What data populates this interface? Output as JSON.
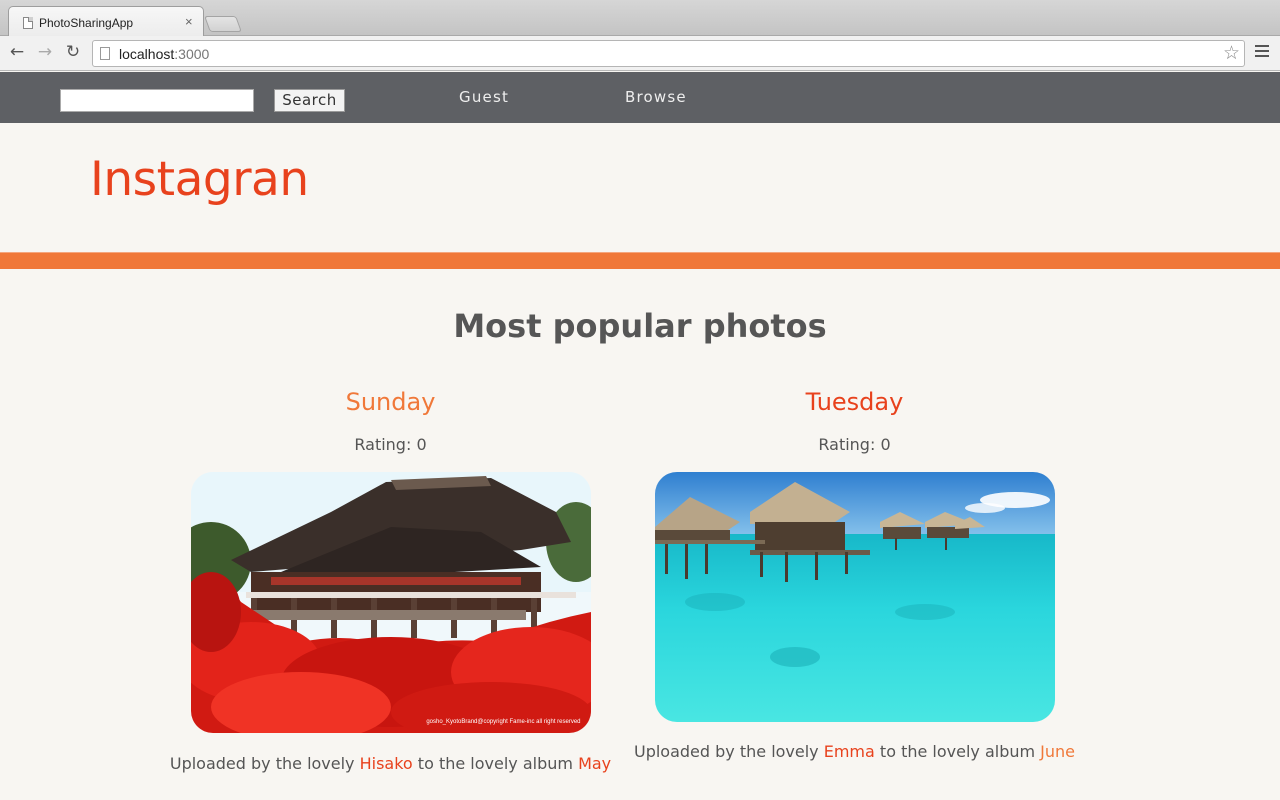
{
  "browser": {
    "tab_title": "PhotoSharingApp",
    "tab_close": "×",
    "url_host": "localhost",
    "url_port": ":3000",
    "back_icon": "←",
    "forward_icon": "→",
    "reload_icon": "↻",
    "star_icon": "☆"
  },
  "nav": {
    "search_value": "",
    "search_label": "Search",
    "guest_label": "Guest",
    "browse_label": "Browse"
  },
  "brand": "Instagran",
  "colors": {
    "nav_bg": "#5e6064",
    "accent_red": "#e8421d",
    "accent_orange": "#f07839",
    "page_bg": "#f8f6f2"
  },
  "section_title": "Most popular photos",
  "photos": [
    {
      "title": "Sunday",
      "rating_label": "Rating: 0",
      "caption_prefix": "Uploaded by the lovely ",
      "uploader": "Hisako",
      "caption_middle": " to the lovely album ",
      "album": "May",
      "photo_credit": "gosho_KyotoBrand@copyright Fame-inc all right reserved"
    },
    {
      "title": "Tuesday",
      "rating_label": "Rating: 0",
      "caption_prefix": "Uploaded by the lovely ",
      "uploader": "Emma",
      "caption_middle": " to the lovely album ",
      "album": "June"
    }
  ]
}
